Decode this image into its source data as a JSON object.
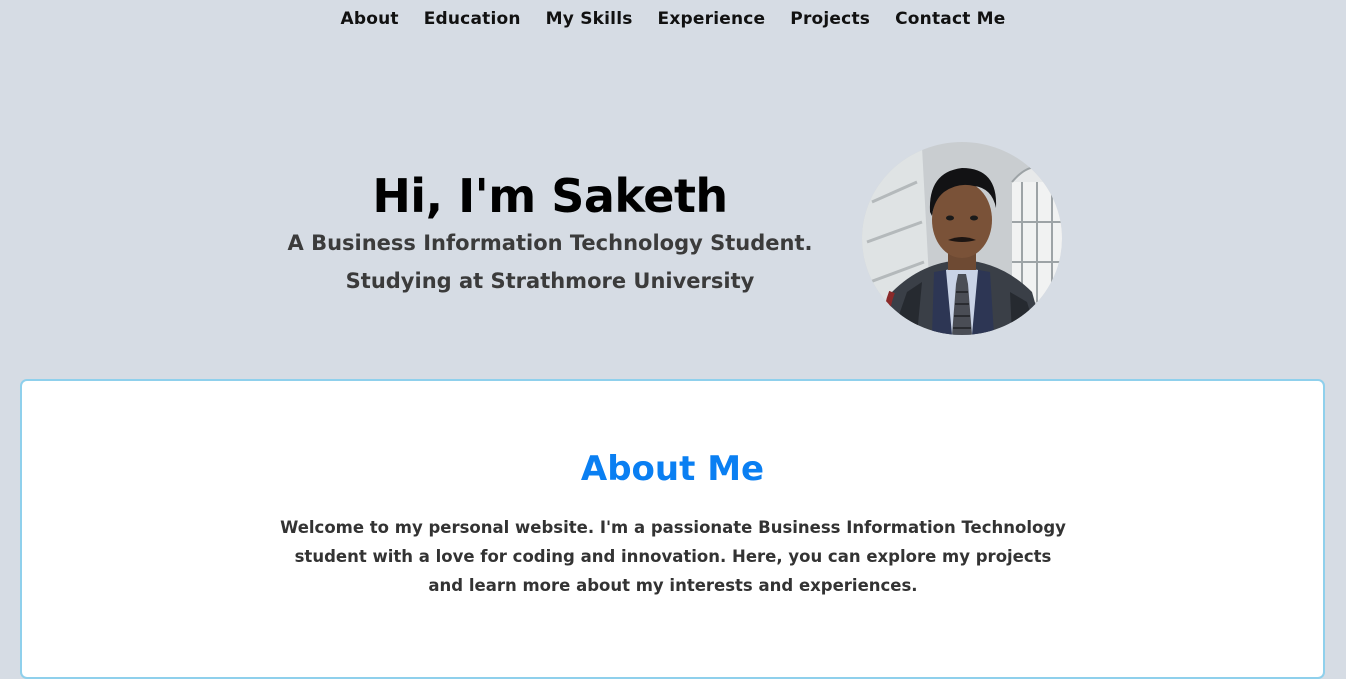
{
  "nav": {
    "items": [
      {
        "label": "About"
      },
      {
        "label": "Education"
      },
      {
        "label": "My Skills"
      },
      {
        "label": "Experience"
      },
      {
        "label": "Projects"
      },
      {
        "label": "Contact Me"
      }
    ]
  },
  "hero": {
    "title": "Hi, I'm Saketh",
    "subtitle_line1": "A Business Information Technology Student.",
    "subtitle_line2": "Studying at Strathmore University"
  },
  "about": {
    "title": "About Me",
    "text": "Welcome to my personal website. I'm a passionate Business Information Technology student with a love for coding and innovation. Here, you can explore my projects and learn more about my interests and experiences."
  },
  "colors": {
    "background": "#d6dce4",
    "accent": "#0a7ff2",
    "card_border": "#8fd0ec"
  }
}
